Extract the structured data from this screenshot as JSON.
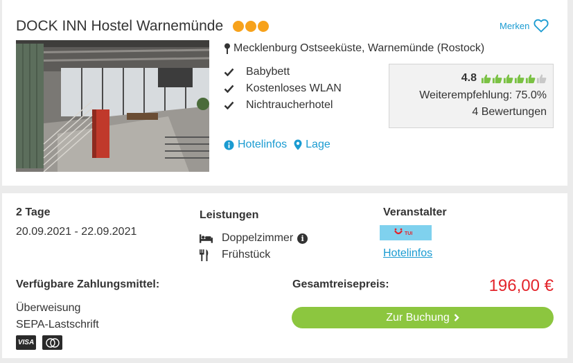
{
  "hotel": {
    "name": "DOCK INN Hostel Warnemünde",
    "stars": 3,
    "merken_label": "Merken",
    "location": "Mecklenburg Ostseeküste, Warnemünde (Rostock)",
    "amenities": [
      "Babybett",
      "Kostenloses WLAN",
      "Nichtraucherhotel"
    ],
    "links": {
      "hotelinfos": "Hotelinfos",
      "lage": "Lage"
    }
  },
  "rating": {
    "score": "4.8",
    "thumbs_filled": 5,
    "thumbs_total": 6,
    "recommendation": "Weiterempfehlung: 75.0%",
    "reviews": "4 Bewertungen"
  },
  "offer": {
    "duration": "2 Tage",
    "dates": "20.09.2021 - 22.09.2021",
    "services_heading": "Leistungen",
    "services": [
      {
        "icon": "bed-icon",
        "label": "Doppelzimmer"
      },
      {
        "icon": "cutlery-icon",
        "label": "Frühstück"
      }
    ],
    "operator_heading": "Veranstalter",
    "operator_logo": "TUI",
    "operator_link": "Hotelinfos"
  },
  "payment": {
    "heading": "Verfügbare Zahlungsmittel:",
    "methods": [
      "Überweisung",
      "SEPA-Lastschrift"
    ],
    "cards": [
      "VISA",
      "Mastercard"
    ]
  },
  "price": {
    "label": "Gesamtreisepreis:",
    "value": "196,00 €",
    "button_label": "Zur Buchung"
  },
  "colors": {
    "accent_blue": "#1a9bd1",
    "star_orange": "#f7a21b",
    "thumb_green": "#7ac143",
    "price_red": "#e3242b",
    "button_green": "#8cc63f",
    "tui_blue": "#7fd1ee"
  }
}
